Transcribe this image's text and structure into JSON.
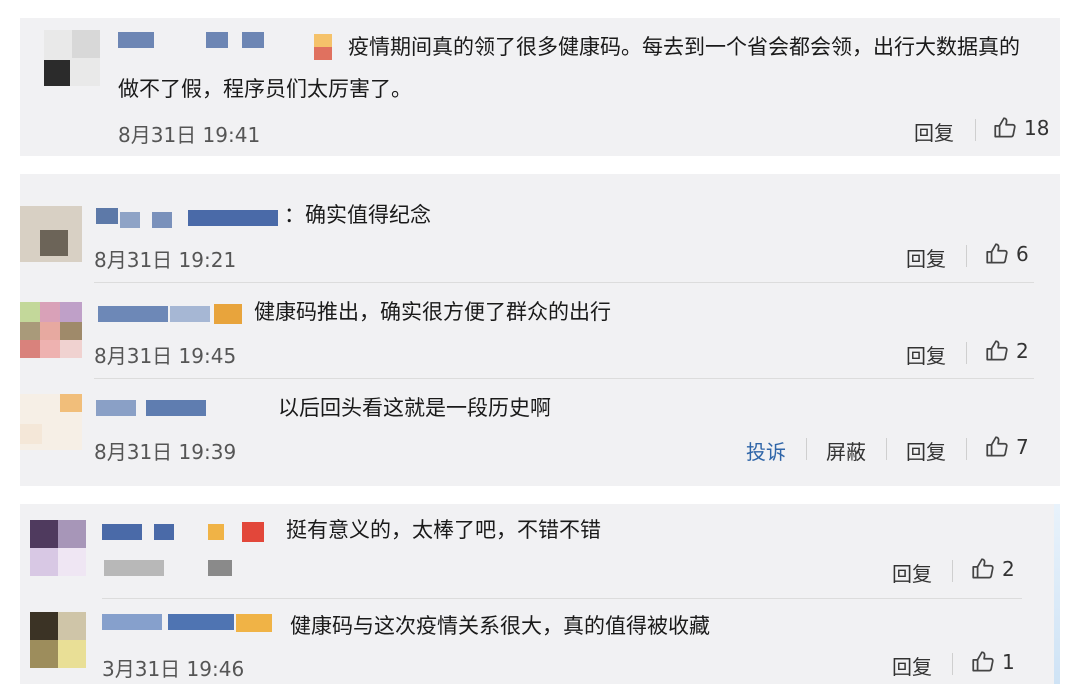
{
  "comments": [
    {
      "text_line1": "疫情期间真的领了很多健康码。每去到一个省会都会领，出行大数据真的",
      "text_line2": "做不了假，程序员们太厉害了。",
      "time": "8月31日 19:41",
      "reply_label": "回复",
      "likes": "18"
    },
    {
      "text": "：确实值得纪念",
      "time": "8月31日 19:21",
      "reply_label": "回复",
      "likes": "6"
    },
    {
      "text": "健康码推出，确实很方便了群众的出行",
      "time": "8月31日 19:45",
      "reply_label": "回复",
      "likes": "2"
    },
    {
      "text": "以后回头看这就是一段历史啊",
      "time": "8月31日 19:39",
      "report_label": "投诉",
      "block_label": "屏蔽",
      "reply_label": "回复",
      "likes": "7"
    },
    {
      "text": "挺有意义的，太棒了吧，不错不错",
      "reply_label": "回复",
      "likes": "2"
    },
    {
      "text": "健康码与这次疫情关系很大，真的值得被收藏",
      "time": "3月31日 19:46",
      "reply_label": "回复",
      "likes": "1"
    }
  ],
  "colors": {
    "card_bg": "#f1f1f3",
    "link_blue": "#2f65a8",
    "text": "#1a1a1a",
    "muted": "#555555"
  },
  "icons": [
    "thumbs-up-icon"
  ]
}
